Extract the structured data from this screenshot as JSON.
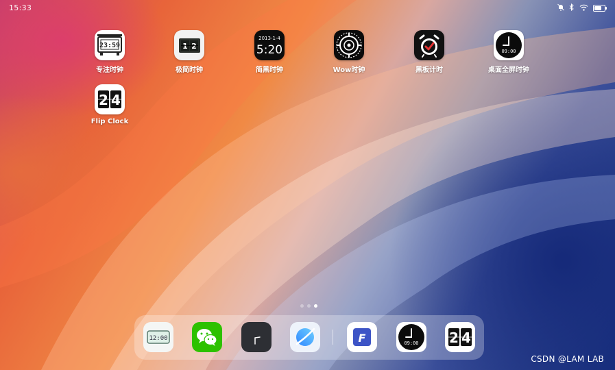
{
  "status_bar": {
    "time": "15:33",
    "icons": [
      "bell-off-icon",
      "bluetooth-icon",
      "wifi-icon",
      "battery-icon"
    ],
    "battery_level": 0.7
  },
  "home_apps": [
    {
      "label": "专注时钟",
      "icon": "digital-clock-icon"
    },
    {
      "label": "极简时钟",
      "icon": "flip-clock-icon"
    },
    {
      "label": "简黑时钟",
      "icon": "date-clock-icon",
      "icon_date": "2013-1-4",
      "icon_time": "5:20"
    },
    {
      "label": "Wow时钟",
      "icon": "radial-clock-icon"
    },
    {
      "label": "黑板计时",
      "icon": "alarm-check-icon"
    },
    {
      "label": "桌面全屏时钟",
      "icon": "analog-clock-icon",
      "icon_time": "09:00"
    },
    {
      "label": "Flip Clock",
      "icon": "flip-clock-24-icon",
      "icon_digits": "24"
    }
  ],
  "page_indicator": {
    "pages": 3,
    "current": 3
  },
  "dock": [
    {
      "icon": "lcd-clock-icon",
      "icon_text": "12:00"
    },
    {
      "icon": "wechat-icon"
    },
    {
      "icon": "dark-corner-clock-icon"
    },
    {
      "icon": "browser-icon"
    },
    {
      "icon": "f-doc-icon",
      "icon_text": "F"
    },
    {
      "icon": "analog-clock-icon",
      "icon_text": "09:00"
    },
    {
      "icon": "flip-clock-24-icon",
      "icon_text": "24"
    }
  ],
  "watermark": "CSDN @LAM LAB",
  "colors": {
    "wechat_green": "#2dc100",
    "browser_blue": "#2f86ff",
    "dark_icon": "#1a1a1a"
  }
}
